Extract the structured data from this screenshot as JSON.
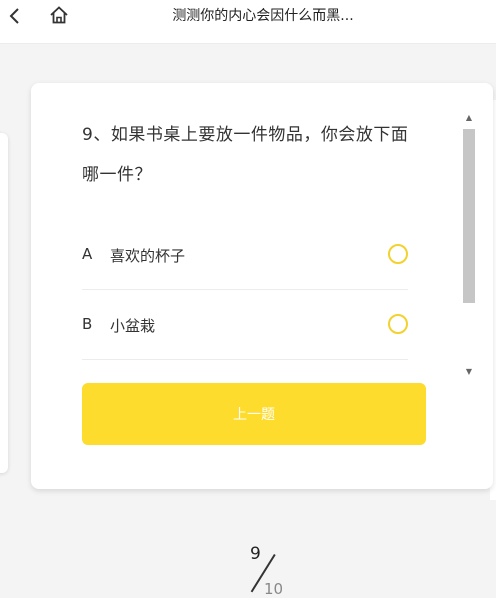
{
  "header": {
    "title": "测测你的内心会因什么而黑...",
    "back_icon": "chevron-left-icon",
    "home_icon": "home-icon"
  },
  "quiz": {
    "question": "9、如果书桌上要放一件物品，你会放下面哪一件？",
    "options": [
      {
        "letter": "A",
        "text": "喜欢的杯子"
      },
      {
        "letter": "B",
        "text": "小盆栽"
      }
    ],
    "prev_label": "上一题"
  },
  "progress": {
    "current": "9",
    "total": "10"
  },
  "colors": {
    "accent": "#fddc2e",
    "radio_border": "#f2d22e",
    "background": "#f4f4f4"
  }
}
